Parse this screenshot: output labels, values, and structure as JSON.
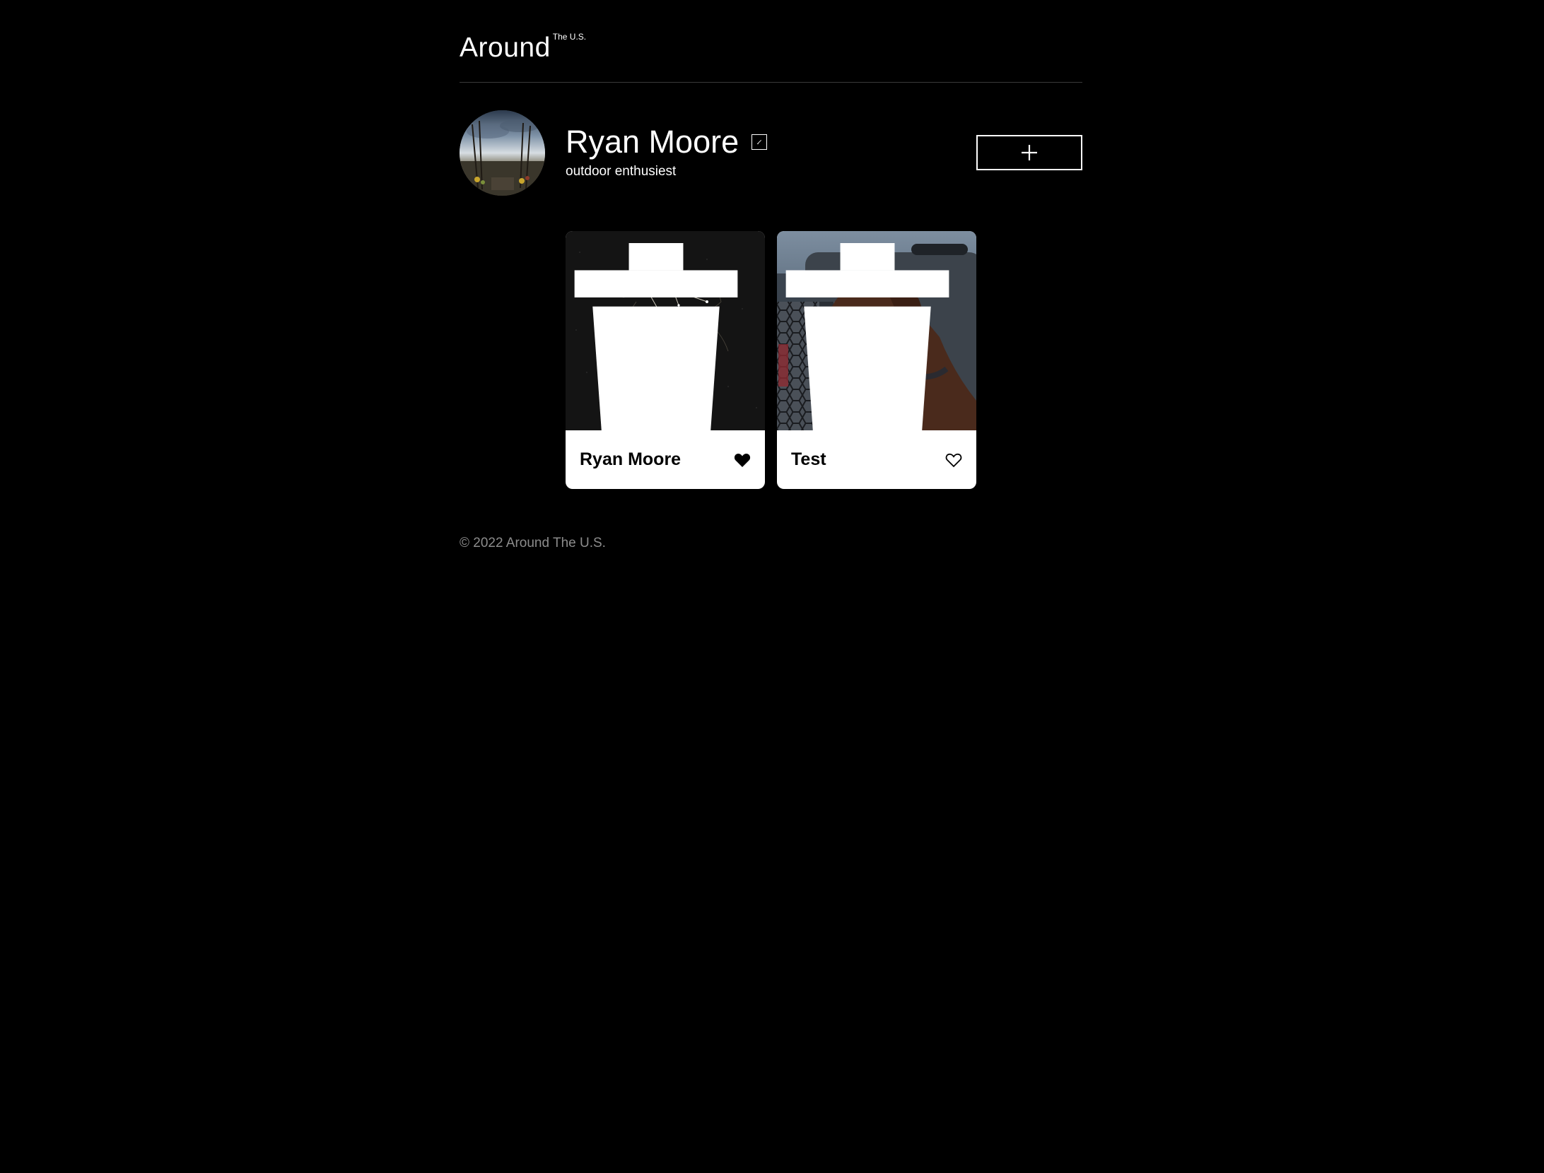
{
  "header": {
    "logo_main": "Around",
    "logo_sup": "The U.S."
  },
  "profile": {
    "name": "Ryan Moore",
    "about": "outdoor enthusiest",
    "edit_icon": "pencil-edit-icon",
    "add_icon": "plus-icon"
  },
  "cards": [
    {
      "title": "Ryan Moore",
      "liked": true,
      "image": "constellation-sagittarius"
    },
    {
      "title": "Test",
      "liked": false,
      "image": "chocolate-labrador-dog"
    }
  ],
  "footer": {
    "copyright": "© 2022 Around The U.S."
  },
  "colors": {
    "background": "#000000",
    "text": "#ffffff",
    "card": "#ffffff",
    "footer_text": "#8c8c8c"
  }
}
